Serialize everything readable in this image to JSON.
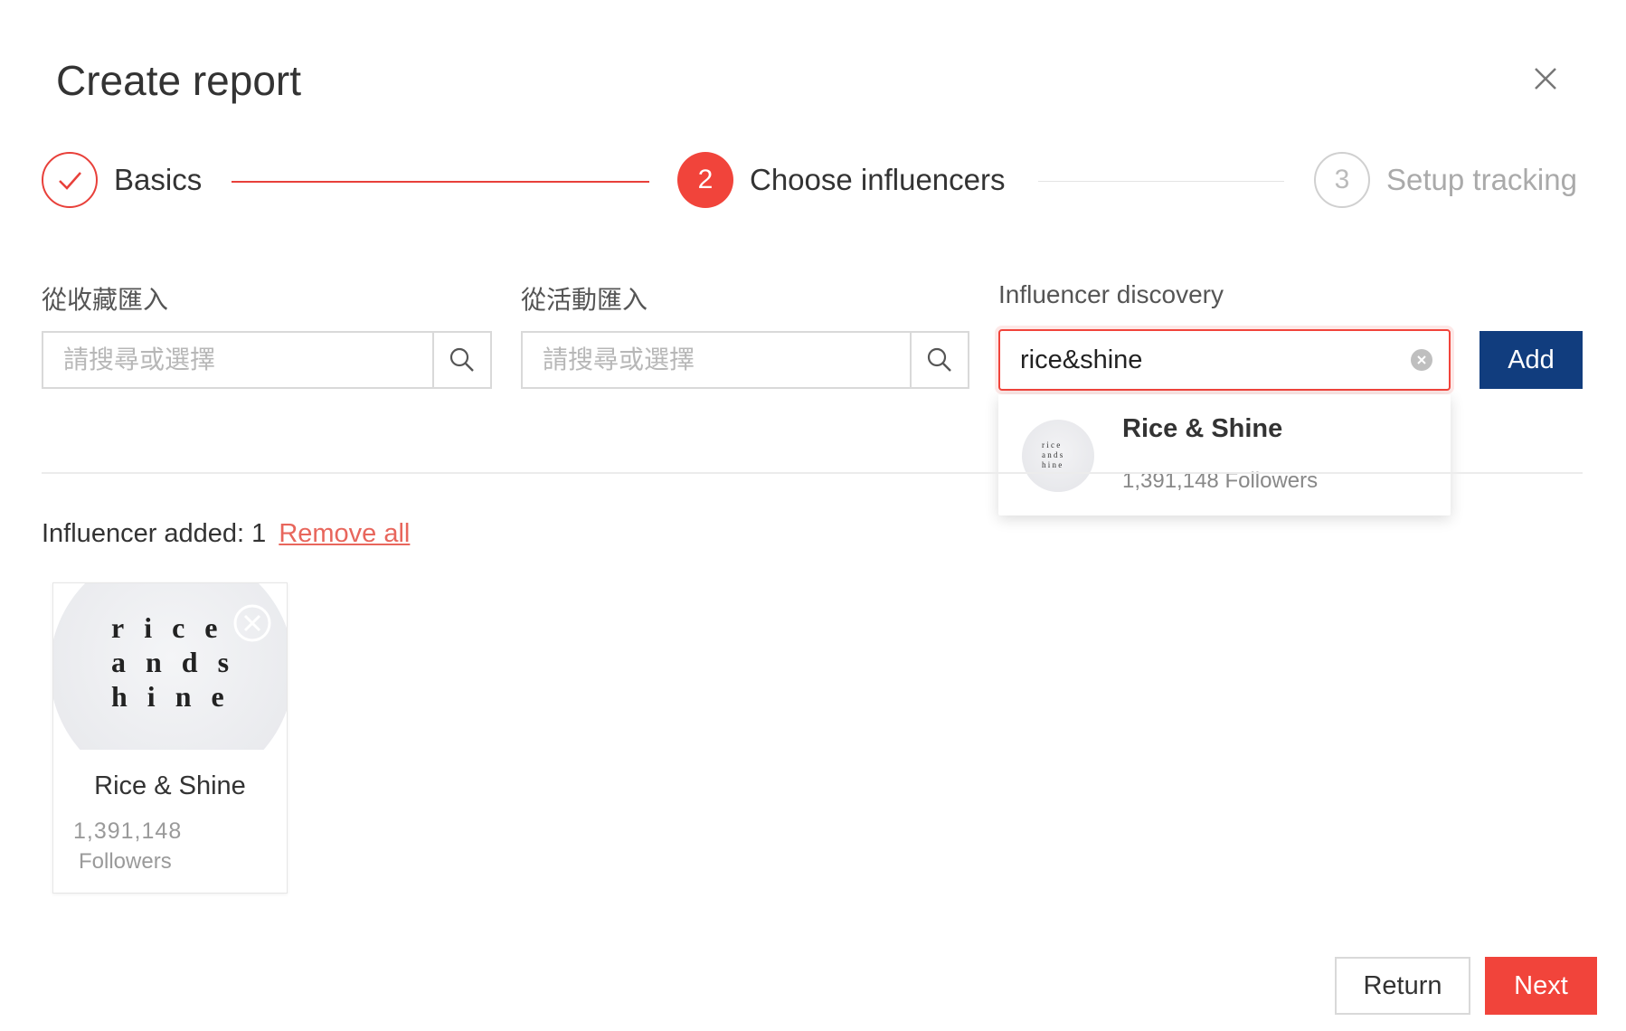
{
  "dialog": {
    "title": "Create report"
  },
  "steps": [
    {
      "label": "Basics",
      "status": "done"
    },
    {
      "number": "2",
      "label": "Choose influencers",
      "status": "active"
    },
    {
      "number": "3",
      "label": "Setup tracking",
      "status": "pending"
    }
  ],
  "import_favorites": {
    "label": "從收藏匯入",
    "placeholder": "請搜尋或選擇"
  },
  "import_campaign": {
    "label": "從活動匯入",
    "placeholder": "請搜尋或選擇"
  },
  "discovery": {
    "label": "Influencer discovery",
    "value": "rice&shine",
    "add_label": "Add",
    "suggestion": {
      "name": "Rice & Shine",
      "followers": "1,391,148 Followers"
    }
  },
  "added": {
    "label": "Influencer added: 1",
    "remove_all": "Remove all",
    "cards": [
      {
        "name": "Rice & Shine",
        "count": "1,391,148",
        "followers_label": "Followers"
      }
    ]
  },
  "footer": {
    "return_label": "Return",
    "next_label": "Next"
  },
  "colors": {
    "accent": "#f1443b",
    "primary": "#113d7e",
    "link": "#e8665c"
  }
}
